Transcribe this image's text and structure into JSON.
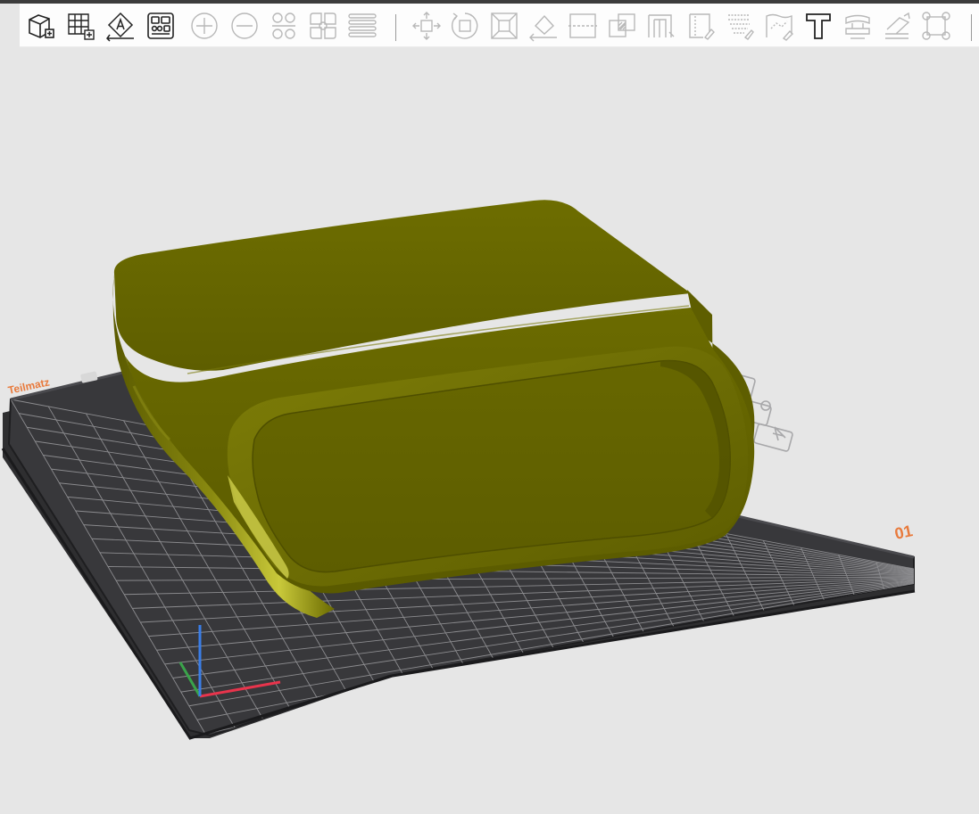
{
  "toolbar": {
    "buttons": [
      {
        "name": "add-object",
        "icon": "add-cube-icon",
        "enabled": true
      },
      {
        "name": "add-plate",
        "icon": "add-plate-grid-icon",
        "enabled": true
      },
      {
        "name": "auto-orient",
        "icon": "auto-orient-icon",
        "enabled": true
      },
      {
        "name": "arrange",
        "icon": "arrange-icon",
        "enabled": true
      },
      {
        "name": "add-instance",
        "icon": "plus-circle-icon",
        "enabled": false
      },
      {
        "name": "remove-instance",
        "icon": "minus-circle-icon",
        "enabled": false
      },
      {
        "name": "split-objects",
        "icon": "split-objects-icon",
        "enabled": false
      },
      {
        "name": "split-parts",
        "icon": "split-parts-icon",
        "enabled": false
      },
      {
        "name": "variable-layer-height",
        "icon": "layers-icon",
        "enabled": false
      },
      {
        "name": "move",
        "icon": "move-icon",
        "enabled": false
      },
      {
        "name": "rotate",
        "icon": "rotate-icon",
        "enabled": false
      },
      {
        "name": "scale",
        "icon": "scale-icon",
        "enabled": false
      },
      {
        "name": "lay-on-face",
        "icon": "lay-on-face-icon",
        "enabled": false
      },
      {
        "name": "cut",
        "icon": "cut-icon",
        "enabled": false
      },
      {
        "name": "mesh-boolean",
        "icon": "boolean-icon",
        "enabled": false
      },
      {
        "name": "support-painting",
        "icon": "support-paint-icon",
        "enabled": false
      },
      {
        "name": "seam-painting",
        "icon": "seam-paint-icon",
        "enabled": false
      },
      {
        "name": "fuzzy-skin",
        "icon": "fuzzy-skin-icon",
        "enabled": false
      },
      {
        "name": "color-painting",
        "icon": "color-paint-icon",
        "enabled": false
      },
      {
        "name": "text-shape",
        "icon": "text-icon",
        "enabled": true
      },
      {
        "name": "measure",
        "icon": "measure-icon",
        "enabled": false
      },
      {
        "name": "assembly",
        "icon": "assembly-icon",
        "enabled": false
      },
      {
        "name": "brim-ears",
        "icon": "brim-ears-icon",
        "enabled": false
      }
    ]
  },
  "plate": {
    "name": "Teilmatz",
    "number": "01"
  },
  "colors": {
    "model": "#6e6e00",
    "model_highlight": "#c8c83a",
    "plate_bed": "#3a3a3d",
    "grid": "#8c8c8f",
    "label": "#e87a3c",
    "axis_x": "#e8344c",
    "axis_y": "#3aa34a",
    "axis_z": "#3a7ee8"
  }
}
